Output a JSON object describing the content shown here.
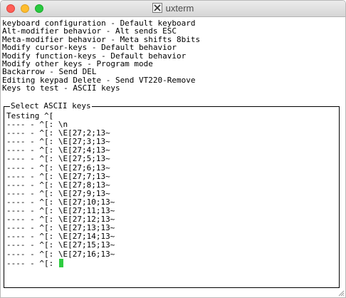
{
  "window": {
    "title": "uxterm",
    "app_icon": "x11-icon"
  },
  "terminal": {
    "header_lines": [
      "keyboard configuration - Default keyboard",
      "Alt-modifier behavior - Alt sends ESC",
      "Meta-modifier behavior - Meta shifts 8bits",
      "Modify cursor-keys - Default behavior",
      "Modify function-keys - Default behavior",
      "Modify other keys - Program mode",
      "Backarrow - Send DEL",
      "Editing keypad Delete - Send VT220-Remove",
      "Keys to test - ASCII keys"
    ],
    "panel": {
      "legend": "Select ASCII keys",
      "lines": [
        "Testing ^[",
        "---- - ^[: \\n",
        "---- - ^[: \\E[27;2;13~",
        "---- - ^[: \\E[27;3;13~",
        "---- - ^[: \\E[27;4;13~",
        "---- - ^[: \\E[27;5;13~",
        "---- - ^[: \\E[27;6;13~",
        "---- - ^[: \\E[27;7;13~",
        "---- - ^[: \\E[27;8;13~",
        "---- - ^[: \\E[27;9;13~",
        "---- - ^[: \\E[27;10;13~",
        "---- - ^[: \\E[27;11;13~",
        "---- - ^[: \\E[27;12;13~",
        "---- - ^[: \\E[27;13;13~",
        "---- - ^[: \\E[27;14;13~",
        "---- - ^[: \\E[27;15;13~",
        "---- - ^[: \\E[27;16;13~"
      ],
      "prompt": "---- - ^[: "
    }
  },
  "colors": {
    "cursor": "#2ecc40",
    "close": "#ff5f57",
    "minimize": "#ffbd2e",
    "maximize": "#28c940"
  }
}
